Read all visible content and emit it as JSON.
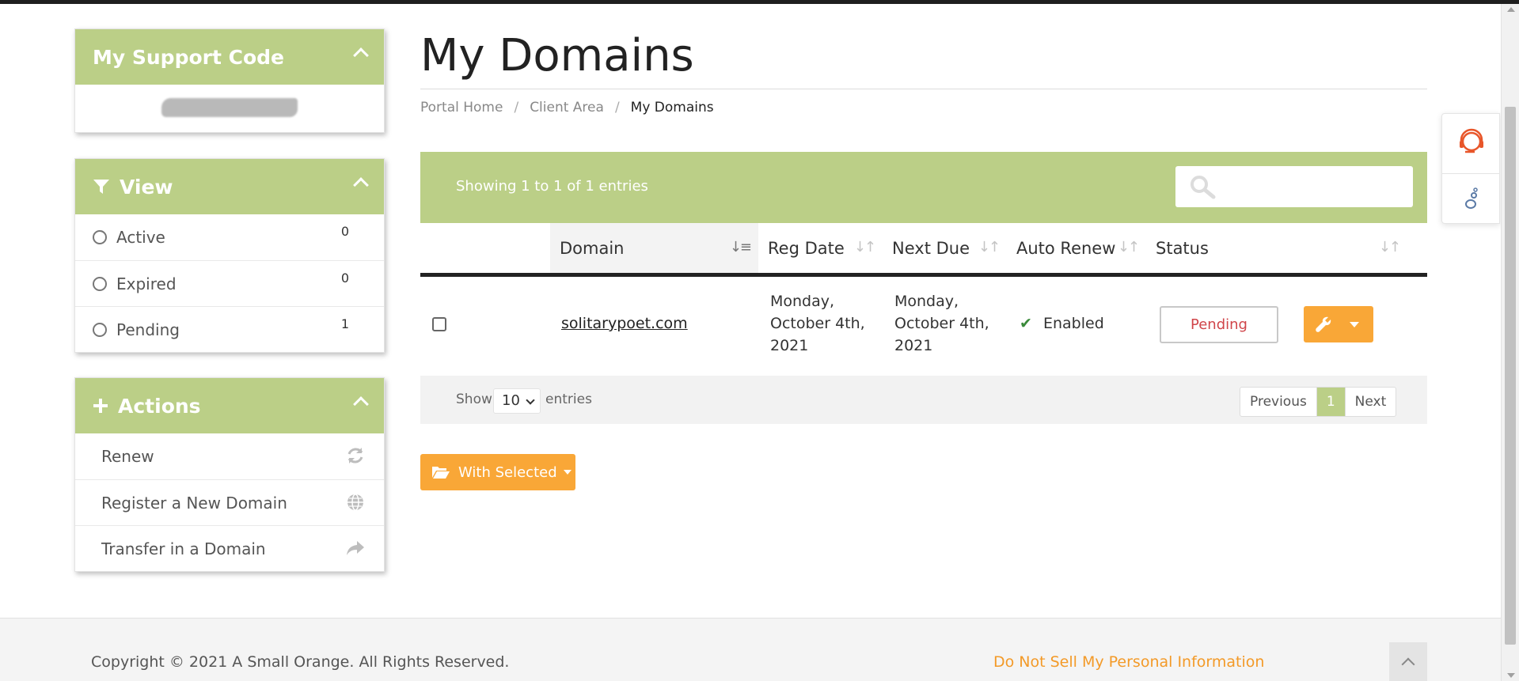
{
  "support": {
    "title": "My Support Code"
  },
  "view": {
    "title": "View",
    "items": [
      {
        "label": "Active",
        "count": "0"
      },
      {
        "label": "Expired",
        "count": "0"
      },
      {
        "label": "Pending",
        "count": "1"
      }
    ]
  },
  "actions": {
    "title": "Actions",
    "items": [
      {
        "label": "Renew",
        "icon": "refresh-icon"
      },
      {
        "label": "Register a New Domain",
        "icon": "globe-icon"
      },
      {
        "label": "Transfer in a Domain",
        "icon": "share-arrow-icon"
      }
    ]
  },
  "page": {
    "title": "My Domains"
  },
  "breadcrumb": [
    "Portal Home",
    "Client Area",
    "My Domains"
  ],
  "table": {
    "showing": "Showing 1 to 1 of 1 entries",
    "columns": [
      "Domain",
      "Reg Date",
      "Next Due",
      "Auto Renew",
      "Status"
    ],
    "rows": [
      {
        "domain": "solitarypoet.com",
        "reg_date": [
          "Monday,",
          "October 4th,",
          "2021"
        ],
        "next_due": [
          "Monday,",
          "October 4th,",
          "2021"
        ],
        "auto_renew": "Enabled",
        "status": "Pending"
      }
    ],
    "show_label": "Show",
    "page_size": "10",
    "entries_label": "entries",
    "pager": {
      "previous": "Previous",
      "current": "1",
      "next": "Next"
    }
  },
  "with_selected": "With Selected",
  "footer": {
    "copyright": "Copyright © 2021 A Small Orange. All Rights Reserved.",
    "do_not_sell": "Do Not Sell My Personal Information"
  },
  "colors": {
    "accent_green": "#bbcf87",
    "accent_orange": "#f9a737",
    "pending_red": "#d0454a"
  }
}
